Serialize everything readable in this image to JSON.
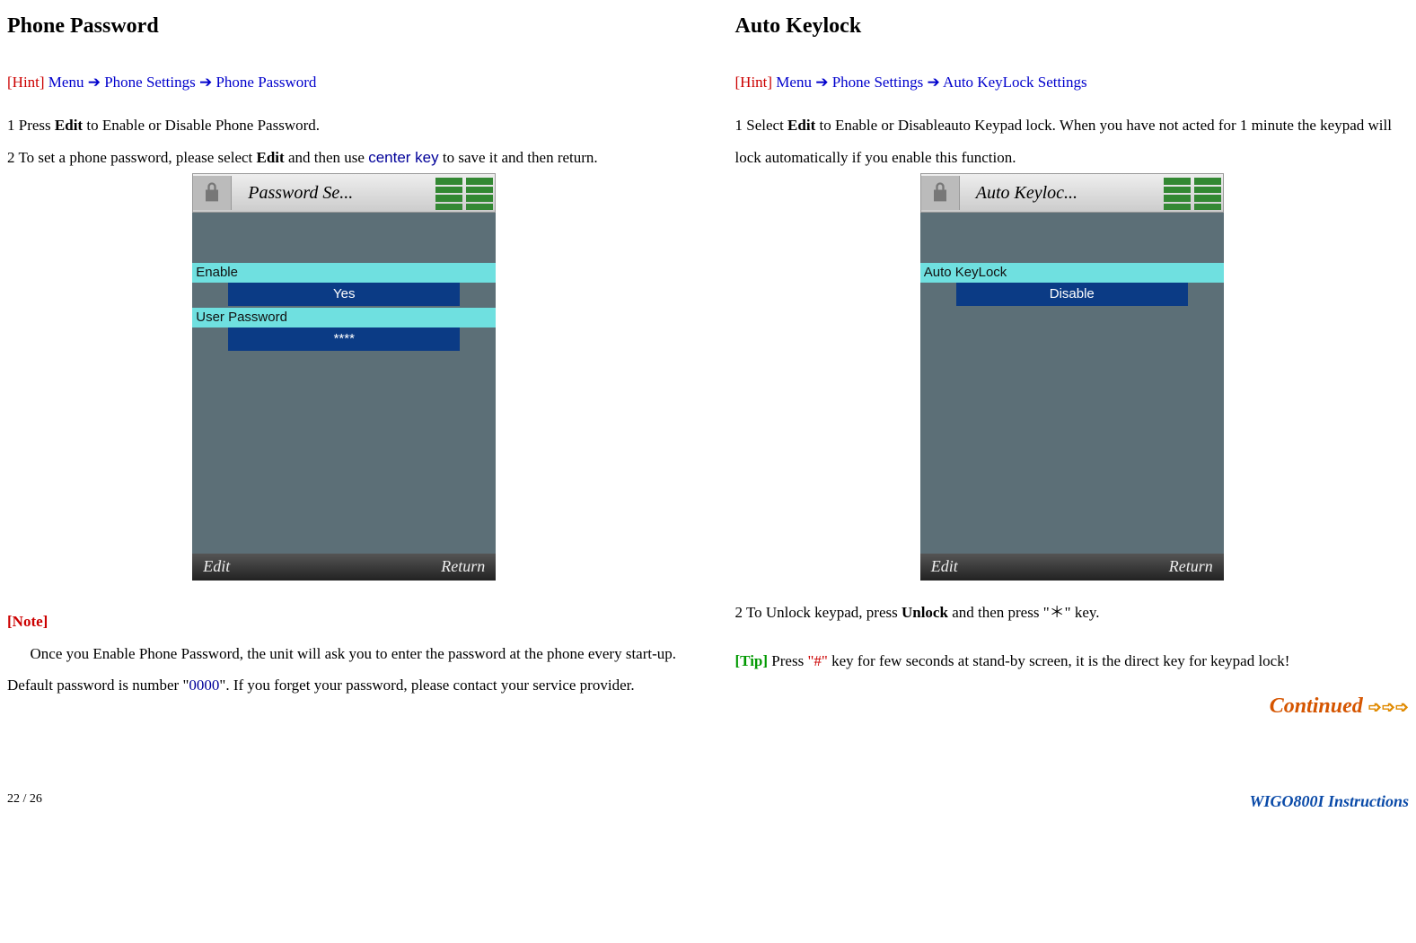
{
  "left": {
    "heading": "Phone Password",
    "hint_label": "[Hint]",
    "hint_nav": "Menu ➔ Phone Settings ➔ Phone Password",
    "step1_num": "1",
    "step1_text_before": " Press ",
    "step1_bold": "Edit",
    "step1_text_after": " to Enable or Disable Phone Password.",
    "step2_num": "2",
    "step2_text_a": " To set a phone password, please select ",
    "step2_bold": "Edit",
    "step2_text_b": " and then use ",
    "step2_center_key": "center key",
    "step2_text_c": " to save it and then return.",
    "note_label": "[Note]",
    "note_text_a": "Once you Enable Phone Password, the unit will ask you to enter the password at the phone every start-up. Default password is number \"",
    "note_zero": "0000",
    "note_text_b": "\". If you forget your password, please contact your service provider.",
    "screenshot": {
      "title": "Password Se...",
      "enable_label": "Enable",
      "enable_value": "Yes",
      "user_password_label": "User Password",
      "user_password_value": "****",
      "soft_left": "Edit",
      "soft_right": "Return"
    }
  },
  "right": {
    "heading": " Auto Keylock",
    "hint_label": "[Hint]",
    "hint_nav": "Menu ➔ Phone Settings ➔ Auto KeyLock Settings",
    "step1_num": "1",
    "step1_text_a": " Select ",
    "step1_bold": "Edit",
    "step1_text_b": " to Enable or Disableauto Keypad lock. When you have not acted for 1 minute the keypad will lock automatically if you enable this function.",
    "screenshot": {
      "title": "Auto Keyloc...",
      "field_label": "Auto KeyLock",
      "field_value": "Disable",
      "soft_left": "Edit",
      "soft_right": "Return"
    },
    "step2_num": "2",
    "step2_text_a": " To Unlock keypad, press ",
    "step2_bold": "Unlock",
    "step2_text_b": " and then press \"＊\" key.",
    "tip_label": "[Tip]",
    "tip_text_a": " Press ",
    "tip_hash": "\"#\"",
    "tip_text_b": " key for few seconds at stand-by screen, it is the direct key for keypad lock!",
    "continued": "Continued  ",
    "continued_arrows": "➩➩➩"
  },
  "footer": {
    "page_num": "22 / 26",
    "doc_title": "WIGO800I Instructions"
  }
}
